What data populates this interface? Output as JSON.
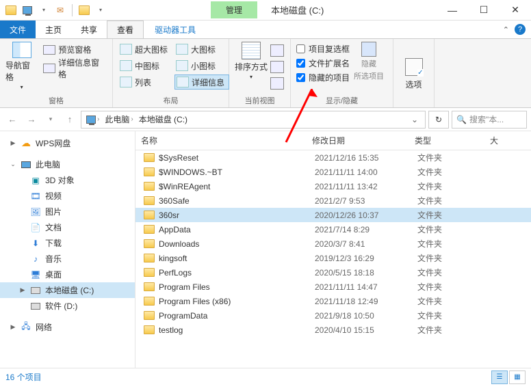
{
  "title": "本地磁盘 (C:)",
  "mgmt_tab": "管理",
  "menu": {
    "file": "文件",
    "home": "主页",
    "share": "共享",
    "view": "查看",
    "tools": "驱动器工具"
  },
  "ribbon": {
    "pane": {
      "nav_label": "导航窗格",
      "preview": "预览窗格",
      "details": "详细信息窗格",
      "group": "窗格"
    },
    "layout": {
      "xl": "超大图标",
      "lg": "大图标",
      "md": "中图标",
      "sm": "小图标",
      "list": "列表",
      "detail": "详细信息",
      "group": "布局"
    },
    "view": {
      "sort": "排序方式",
      "group": "当前视图"
    },
    "showhide": {
      "chk1": "项目复选框",
      "chk2": "文件扩展名",
      "chk3": "隐藏的项目",
      "hide": "隐藏",
      "sel": "所选项目",
      "group": "显示/隐藏"
    },
    "options": "选项"
  },
  "breadcrumb": {
    "pc": "此电脑",
    "drive": "本地磁盘 (C:)"
  },
  "search_placeholder": "搜索\"本...",
  "tree": {
    "wps": "WPS网盘",
    "pc": "此电脑",
    "d3": "3D 对象",
    "video": "视频",
    "pic": "图片",
    "doc": "文档",
    "dl": "下载",
    "music": "音乐",
    "desktop": "桌面",
    "c": "本地磁盘 (C:)",
    "d": "软件 (D:)",
    "net": "网络"
  },
  "columns": {
    "name": "名称",
    "date": "修改日期",
    "type": "类型",
    "size": "大"
  },
  "type_folder": "文件夹",
  "files": [
    {
      "name": "$SysReset",
      "date": "2021/12/16 15:35"
    },
    {
      "name": "$WINDOWS.~BT",
      "date": "2021/11/11 14:00"
    },
    {
      "name": "$WinREAgent",
      "date": "2021/11/11 13:42"
    },
    {
      "name": "360Safe",
      "date": "2021/2/7 9:53"
    },
    {
      "name": "360sr",
      "date": "2020/12/26 10:37",
      "sel": true
    },
    {
      "name": "AppData",
      "date": "2021/7/14 8:29"
    },
    {
      "name": "Downloads",
      "date": "2020/3/7 8:41"
    },
    {
      "name": "kingsoft",
      "date": "2019/12/3 16:29"
    },
    {
      "name": "PerfLogs",
      "date": "2020/5/15 18:18"
    },
    {
      "name": "Program Files",
      "date": "2021/11/11 14:47"
    },
    {
      "name": "Program Files (x86)",
      "date": "2021/11/18 12:49"
    },
    {
      "name": "ProgramData",
      "date": "2021/9/18 10:50"
    },
    {
      "name": "testlog",
      "date": "2020/4/10 15:15"
    }
  ],
  "status": "16 个项目"
}
